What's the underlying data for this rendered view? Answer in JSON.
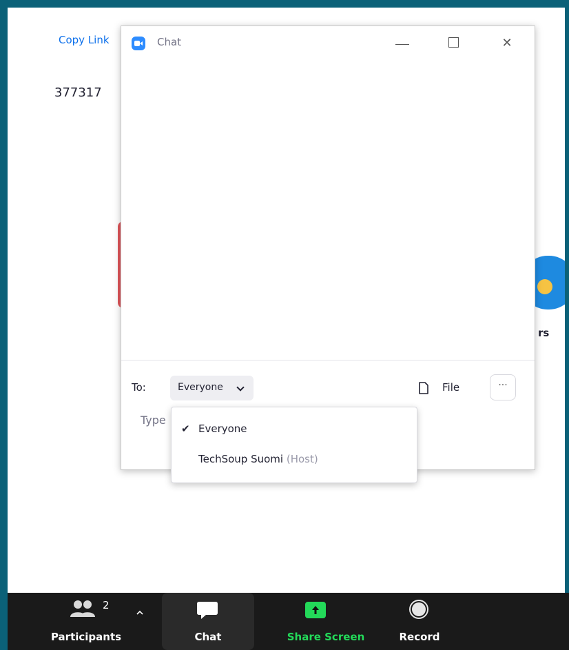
{
  "background": {
    "copy_link": "Copy Link",
    "meeting_id": "377317",
    "partial_label": "rs"
  },
  "chat_window": {
    "title": "Chat",
    "to_label": "To:",
    "to_value": "Everyone",
    "file_label": "File",
    "more_label": "···",
    "type_placeholder": "Type"
  },
  "recipient_dropdown": {
    "options": [
      {
        "label": "Everyone",
        "selected": true,
        "suffix": ""
      },
      {
        "label": "TechSoup Suomi",
        "selected": false,
        "suffix": "(Host)"
      }
    ]
  },
  "toolbar": {
    "participants_label": "Participants",
    "participants_count": "2",
    "chat_label": "Chat",
    "share_label": "Share Screen",
    "record_label": "Record"
  },
  "colors": {
    "frame": "#0b6178",
    "link": "#0e71eb",
    "toolbar": "#1a1a1a",
    "share_green": "#23d959",
    "zoom_blue": "#2d8cff"
  }
}
